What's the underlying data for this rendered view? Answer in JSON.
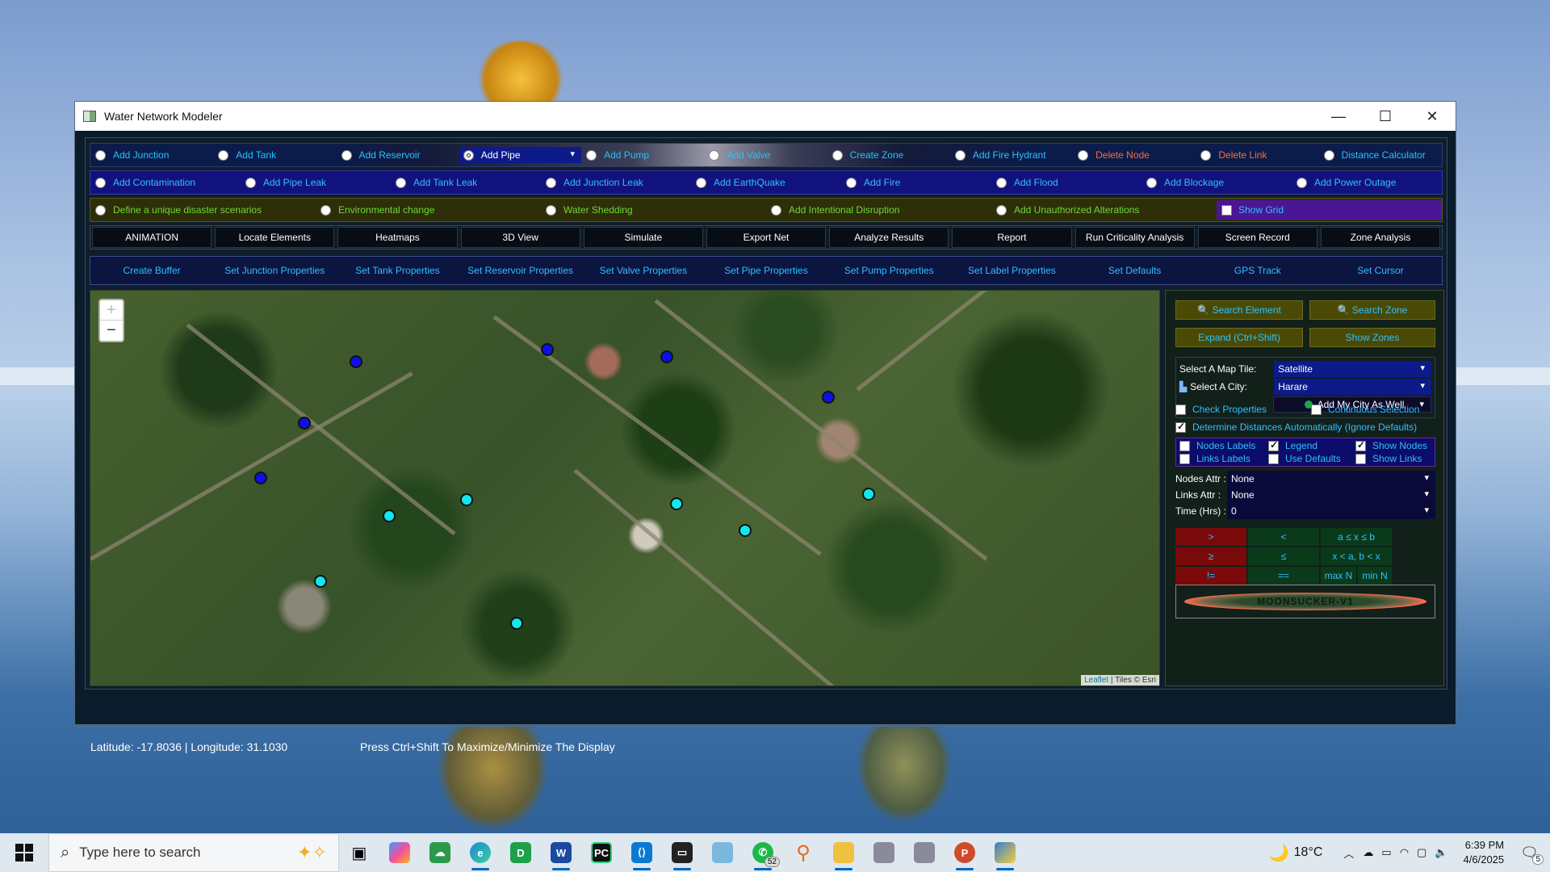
{
  "window": {
    "title": "Water Network Modeler",
    "minimize": "—",
    "maximize": "☐",
    "close": "✕"
  },
  "row1": [
    {
      "label": "Add Junction",
      "color": "cyan"
    },
    {
      "label": "Add Tank",
      "color": "cyan"
    },
    {
      "label": "Add Reservoir",
      "color": "cyan"
    },
    {
      "label": "Add Pipe",
      "color": "cyan",
      "selected": true
    },
    {
      "label": "Add Pump",
      "color": "cyan"
    },
    {
      "label": "Add Valve",
      "color": "cyan"
    },
    {
      "label": "Create Zone",
      "color": "cyan"
    },
    {
      "label": "Add Fire Hydrant",
      "color": "cyan"
    },
    {
      "label": "Delete Node",
      "color": "red"
    },
    {
      "label": "Delete Link",
      "color": "red"
    },
    {
      "label": "Distance Calculator",
      "color": "cyan"
    }
  ],
  "row2": [
    "Add Contamination",
    "Add Pipe Leak",
    "Add Tank Leak",
    "Add Junction Leak",
    "Add EarthQuake",
    "Add Fire",
    "Add Flood",
    "Add Blockage",
    "Add Power Outage"
  ],
  "row3": {
    "radios": [
      "Define a unique disaster scenarios",
      "Environmental change",
      "Water Shedding",
      "Add Intentional Disruption",
      "Add Unauthorized Alterations"
    ],
    "show_grid": "Show Grid"
  },
  "toolbar": [
    "ANIMATION",
    "Locate Elements",
    "Heatmaps",
    "3D View",
    "Simulate",
    "Export Net",
    "Analyze Results",
    "Report",
    "Run Criticality Analysis",
    "Screen Record",
    "Zone Analysis"
  ],
  "properties": [
    "Create Buffer",
    "Set Junction Properties",
    "Set Tank Properties",
    "Set Reservoir Properties",
    "Set Valve Properties",
    "Set Pipe Properties",
    "Set Pump Properties",
    "Set Label Properties",
    "Set Defaults",
    "GPS Track",
    "Set Cursor"
  ],
  "map": {
    "zoom_in": "+",
    "zoom_out": "−",
    "attribution_link": "Leaflet",
    "attribution_text": " | Tiles © Esri",
    "tank_color": "#0d10e8",
    "junction_color": "#10e8f0"
  },
  "side": {
    "search_element": "🔍 Search Element",
    "search_zone": "🔍 Search Zone",
    "expand": "Expand (Ctrl+Shift)",
    "show_zones": "Show Zones",
    "map_tile_label": "Select A Map Tile:",
    "map_tile_value": "Satellite",
    "city_label": "Select A City:",
    "city_value": "Harare",
    "add_city": "Add My City As Well",
    "check_properties": "Check Properties",
    "continuous_selection": "Continuous Selection",
    "determine_distances": "Determine Distances Automatically (Ignore Defaults)",
    "nodes_labels": "Nodes Labels",
    "legend": "Legend",
    "show_nodes": "Show Nodes",
    "links_labels": "Links Labels",
    "use_defaults": "Use Defaults",
    "show_links": "Show Links",
    "nodes_attr_label": "Nodes Attr :",
    "nodes_attr_value": "None",
    "links_attr_label": "Links Attr :",
    "links_attr_value": "None",
    "time_label": "Time (Hrs) :",
    "time_value": "0",
    "ops": [
      ">",
      "<",
      "a ≤  x  ≤ b",
      "≥",
      "≤",
      "x < a, b < x",
      "!=",
      "==",
      "max N",
      "min N"
    ],
    "logo": "MOONSUCKER-V1"
  },
  "status": {
    "coords": "Latitude: -17.8036 | Longitude: 31.1030",
    "hint": "Press Ctrl+Shift  To Maximize/Minimize The Display"
  },
  "taskbar": {
    "search_placeholder": "Type here to search",
    "whatsapp_badge": "52",
    "temperature": "18°C",
    "time": "6:39 PM",
    "date": "4/6/2025",
    "notif_count": "5"
  }
}
